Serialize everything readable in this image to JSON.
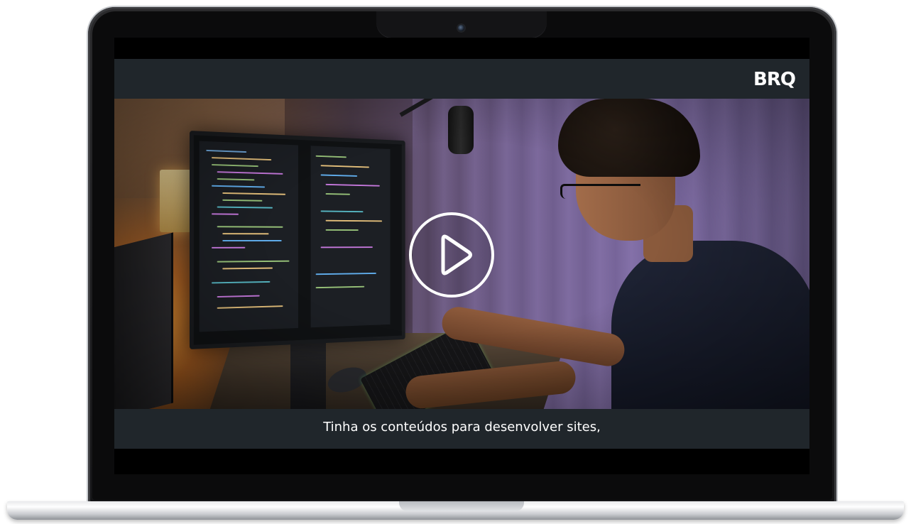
{
  "device": "laptop",
  "player": {
    "logo_text": "BRQ",
    "play_icon": "play-circle-icon",
    "subtitle": "Tinha os conteúdos para desenvolver sites,"
  },
  "colors": {
    "player_bar": "#20262b",
    "screen_black": "#000000",
    "text": "#ffffff"
  }
}
